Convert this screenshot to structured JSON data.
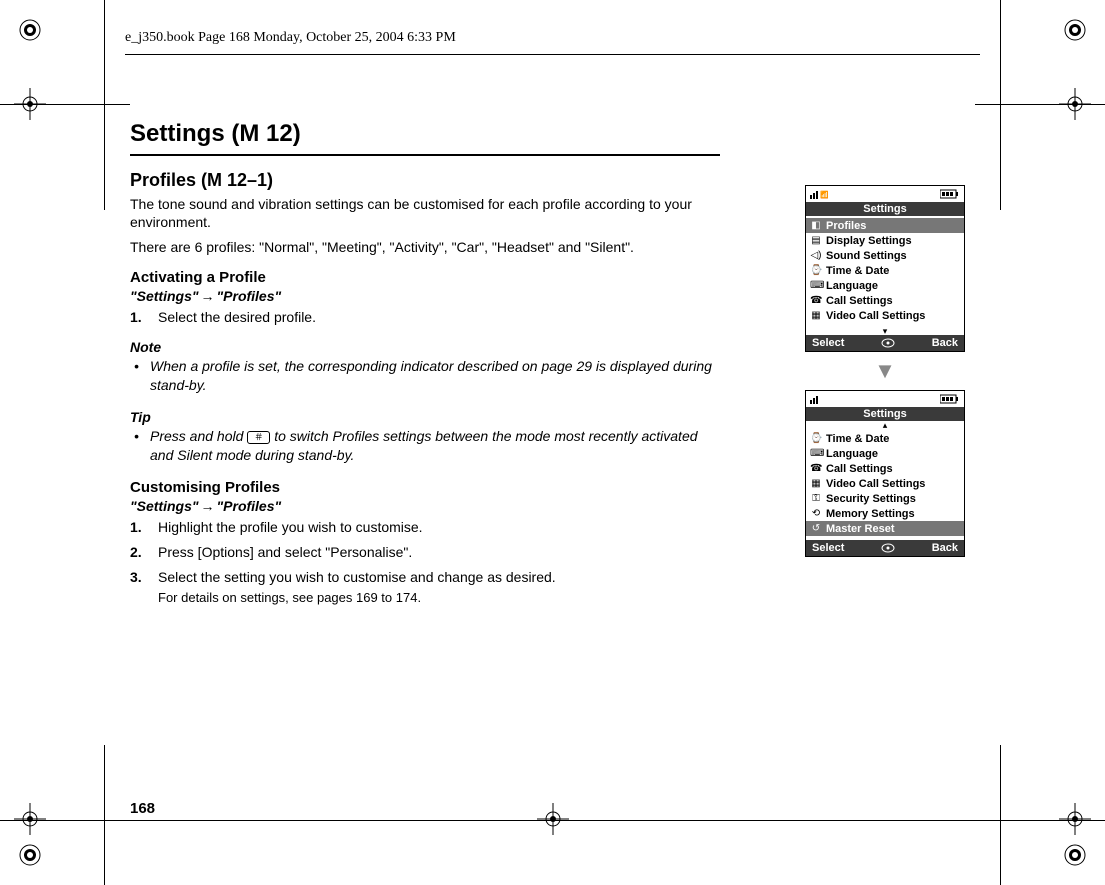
{
  "header_stamp": "e_j350.book  Page 168  Monday, October 25, 2004  6:33 PM",
  "page_number": "168",
  "heading": "Settings (M 12)",
  "section": {
    "title": "Profiles (M 12–1)",
    "intro": "The tone sound and vibration settings can be customised for each profile according to your environment.",
    "profiles_line": "There are 6 profiles: \"Normal\", \"Meeting\", \"Activity\", \"Car\", \"Headset\" and \"Silent\".",
    "activating": {
      "heading": "Activating a Profile",
      "nav_left": "\"Settings\"",
      "nav_right": "\"Profiles\"",
      "steps": [
        {
          "num": "1.",
          "text": "Select the desired profile."
        }
      ]
    },
    "note": {
      "label": "Note",
      "text": "When a profile is set, the corresponding indicator described on page 29 is displayed during stand-by."
    },
    "tip": {
      "label": "Tip",
      "text_before": "Press and hold ",
      "key_glyph": "＃",
      "text_after": " to switch Profiles settings between the mode most recently activated and Silent mode during stand-by."
    },
    "customising": {
      "heading": "Customising Profiles",
      "nav_left": "\"Settings\"",
      "nav_right": "\"Profiles\"",
      "steps": [
        {
          "num": "1.",
          "text": "Highlight the profile you wish to customise."
        },
        {
          "num": "2.",
          "text": "Press [Options] and select \"Personalise\"."
        },
        {
          "num": "3.",
          "text": "Select the setting you wish to customise and change as desired.",
          "detail": "For details on settings, see pages 169 to 174."
        }
      ]
    }
  },
  "phone1": {
    "title": "Settings",
    "items": [
      {
        "icon": "◧",
        "label": "Profiles",
        "selected": true
      },
      {
        "icon": "▤",
        "label": "Display Settings",
        "selected": false
      },
      {
        "icon": "◁)",
        "label": "Sound Settings",
        "selected": false
      },
      {
        "icon": "⌚",
        "label": "Time & Date",
        "selected": false
      },
      {
        "icon": "⌨",
        "label": "Language",
        "selected": false
      },
      {
        "icon": "☎",
        "label": "Call Settings",
        "selected": false
      },
      {
        "icon": "▦",
        "label": "Video Call Settings",
        "selected": false
      }
    ],
    "soft_left": "Select",
    "soft_right": "Back",
    "show_down_arrow": true,
    "show_up_arrow": false
  },
  "phone2": {
    "title": "Settings",
    "items": [
      {
        "icon": "⌚",
        "label": "Time & Date",
        "selected": false
      },
      {
        "icon": "⌨",
        "label": "Language",
        "selected": false
      },
      {
        "icon": "☎",
        "label": "Call Settings",
        "selected": false
      },
      {
        "icon": "▦",
        "label": "Video Call Settings",
        "selected": false
      },
      {
        "icon": "⚿",
        "label": "Security Settings",
        "selected": false
      },
      {
        "icon": "⟲",
        "label": "Memory Settings",
        "selected": false
      },
      {
        "icon": "↺",
        "label": "Master Reset",
        "selected": true
      }
    ],
    "soft_left": "Select",
    "soft_right": "Back",
    "show_down_arrow": false,
    "show_up_arrow": true
  }
}
